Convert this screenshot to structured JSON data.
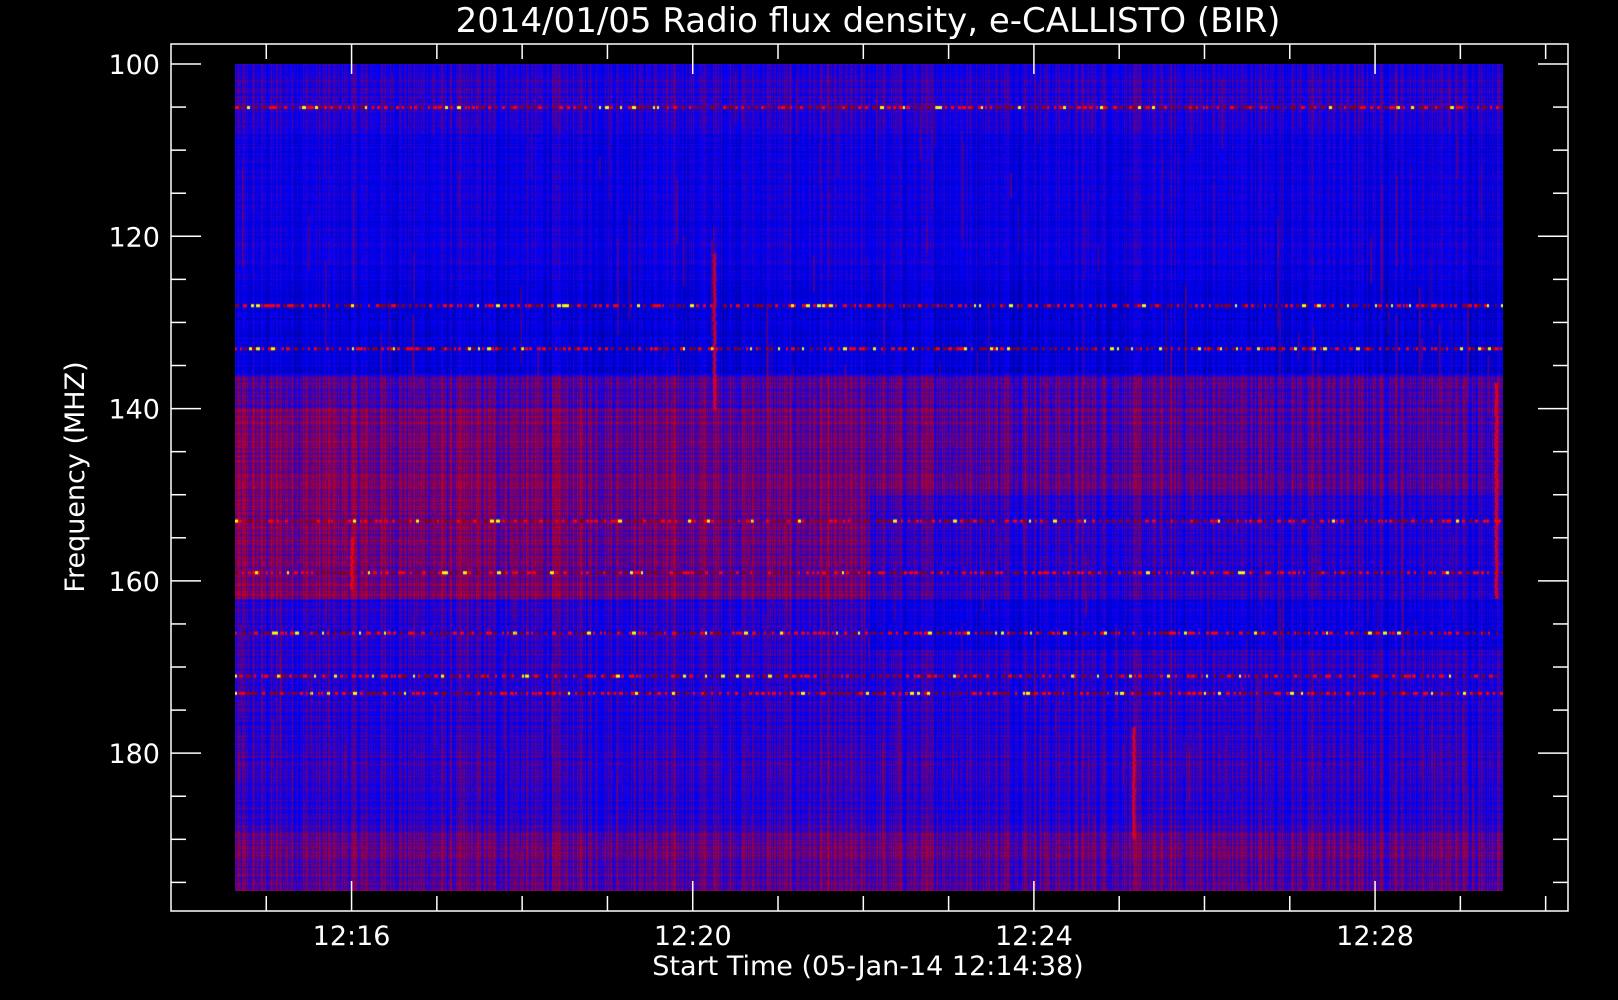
{
  "chart_data": {
    "type": "heatmap",
    "title": "2014/01/05  Radio flux density, e-CALLISTO (BIR)",
    "xlabel": "Start Time (05-Jan-14 12:14:38)",
    "ylabel": "Frequency (MHZ)",
    "x_ticks": [
      "12:16",
      "12:20",
      "12:24",
      "12:28"
    ],
    "y_ticks": [
      "100",
      "120",
      "140",
      "160",
      "180"
    ],
    "x_range": [
      "12:14:38",
      "12:29:30"
    ],
    "ylim": [
      100,
      196
    ],
    "y_inverted": true,
    "colormap": "blue-red-yellow",
    "background_color": "#0000ff",
    "hot_color": "#ff0000",
    "peak_color": "#ffff00",
    "bursts": [
      {
        "time": "12:20:15",
        "freq_from": 122,
        "freq_to": 140
      },
      {
        "time": "12:25:10",
        "freq_from": 177,
        "freq_to": 190
      },
      {
        "time": "12:29:25",
        "freq_from": 137,
        "freq_to": 162
      },
      {
        "time": "12:16:00",
        "freq_from": 155,
        "freq_to": 161
      }
    ],
    "interference_bands_mhz": [
      105,
      128,
      133,
      153,
      159,
      166,
      171,
      173
    ]
  }
}
